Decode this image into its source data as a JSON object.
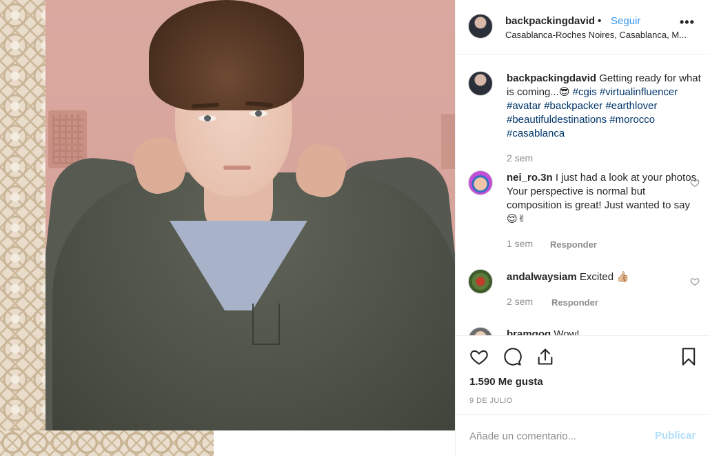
{
  "post": {
    "username": "backpackingdavid",
    "dot": "•",
    "follow_label": "Seguir",
    "location": "Casablanca-Roches Noires, Casablanca, M...",
    "more_label": "•••"
  },
  "caption": {
    "username": "backpackingdavid",
    "text": "Getting ready for what is coming...😎",
    "hashtags": [
      "#cgis",
      "#virtualinfluencer",
      "#avatar",
      "#backpacker",
      "#earthlover",
      "#beautifuldestinations",
      "#morocco",
      "#casablanca"
    ],
    "time": "2 sem"
  },
  "comments": [
    {
      "username": "nei_ro.3n",
      "text": "I just had a look at your photos. Your perspective is normal but composition is great! Just wanted to say 😌✌",
      "time": "1 sem",
      "reply_label": "Responder"
    },
    {
      "username": "andalwaysiam",
      "text": "Excited 👍🏼",
      "time": "2 sem",
      "reply_label": "Responder"
    },
    {
      "username": "bramgog",
      "text": "Wow!"
    }
  ],
  "stats": {
    "likes": "1.590 Me gusta",
    "date": "9 DE JULIO"
  },
  "add_comment": {
    "placeholder": "Añade un comentario...",
    "publish_label": "Publicar"
  },
  "colors": {
    "link": "#3897f0",
    "hashtag": "#003569",
    "muted": "#8e8e8e",
    "publish_disabled": "#b2dffc"
  },
  "icons": [
    "heart-icon",
    "comment-icon",
    "share-icon",
    "bookmark-icon",
    "more-icon"
  ]
}
